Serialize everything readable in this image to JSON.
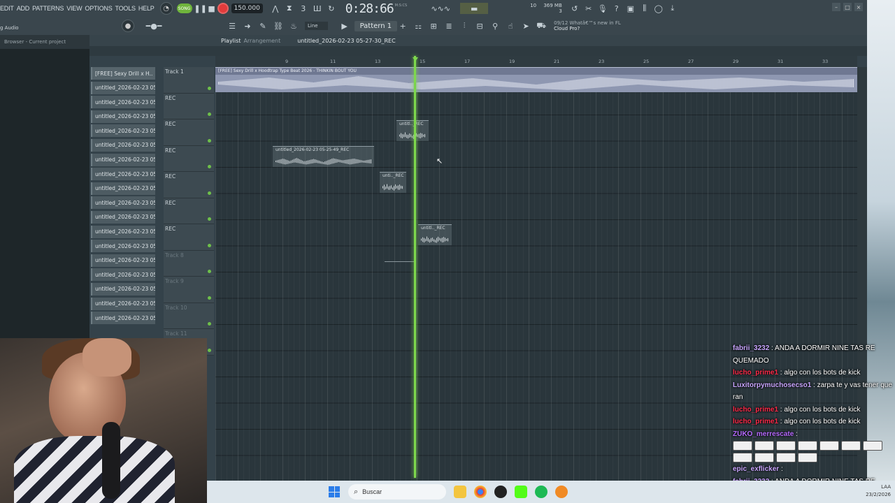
{
  "menu": [
    "EDIT",
    "ADD",
    "PATTERNS",
    "VIEW",
    "OPTIONS",
    "TOOLS",
    "HELP"
  ],
  "transport": {
    "mode_label": "SONG",
    "tempo": "150.000",
    "time": "0:28:66",
    "time_unit": "M:S:CS",
    "cpu": "10",
    "ram": "369 MB",
    "poly": "3"
  },
  "toolbar2": {
    "snap": "Line",
    "pattern": "Pattern 1",
    "news_line1": "09/12  Whatâ€™s new in FL",
    "news_line2": "Cloud Pro?"
  },
  "browser": {
    "header": "Browser - Current project",
    "mic_label": "g Audio"
  },
  "playlist": {
    "title": "Playlist",
    "title_sep": "Arrangement",
    "project": "untitled_2026-02-23 05-27-30_REC",
    "bars": [
      "9",
      "11",
      "13",
      "15",
      "17",
      "19",
      "21",
      "23",
      "25",
      "27",
      "29",
      "31",
      "33",
      "35",
      "37"
    ],
    "patterns": [
      "[FREE] Sexy Drill x H..",
      "untitled_2026-02-23 05-..",
      "untitled_2026-02-23 05-..",
      "untitled_2026-02-23 05-..",
      "untitled_2026-02-23 05-..",
      "untitled_2026-02-23 05-..",
      "untitled_2026-02-23 05-..",
      "untitled_2026-02-23 05-..",
      "untitled_2026-02-23 05-..",
      "untitled_2026-02-23 05-..",
      "untitled_2026-02-23 05-..",
      "untitled_2026-02-23 05-..",
      "untitled_2026-02-23 05-..",
      "untitled_2026-02-23 05-..",
      "untitled_2026-02-23 05-..",
      "untitled_2026-02-23 05-..",
      "untitled_2026-02-23 05-..",
      "untitled_2026-02-23 05-.."
    ],
    "tracks": [
      "Track 1",
      "REC",
      "REC",
      "REC",
      "REC",
      "REC",
      "REC",
      "Track 8",
      "Track 9",
      "Track 10",
      "Track 11"
    ],
    "main_clip_label": "[FREE] Sexy Drill x Hoodtrap Type Beat 2026 - THINKIN BOUT YOU",
    "clip_labels": {
      "c1": "untitl.._REC",
      "c2": "untitled_2026-02-23 05-25-49_REC",
      "c3": "unti.._REC",
      "c4": "untitl.._REC"
    }
  },
  "chat": [
    {
      "user": "fabrii_3232",
      "color": "#c9a6ff",
      "text": " : ANDA A DORMIR NINE TAS RE QUEMADO"
    },
    {
      "user": "lucho_prime1",
      "color": "#ff2b4a",
      "text": " : algo con los bots de kick"
    },
    {
      "user": "Luxitorpymuchosecso1",
      "color": "#c9a6ff",
      "text": " : zarpa te y vas tener que ran"
    },
    {
      "user": "lucho_prime1",
      "color": "#ff2b4a",
      "text": " : algo con los bots de kick"
    },
    {
      "user": "lucho_prime1",
      "color": "#ff2b4a",
      "text": " : algo con los bots de kick"
    },
    {
      "user": "ZUKO_merrescate",
      "color": "#b66bff",
      "text": " :"
    },
    {
      "user": "epic_exflicker",
      "color": "#c9a6ff",
      "text": " :"
    },
    {
      "user": "fabrii_3232",
      "color": "#c9a6ff",
      "text": " : ANDA A DORMIR NINE TAS RE QUEMADO"
    }
  ],
  "taskbar": {
    "search": "Buscar",
    "lang": "LAA",
    "date": "23/2/2026"
  }
}
